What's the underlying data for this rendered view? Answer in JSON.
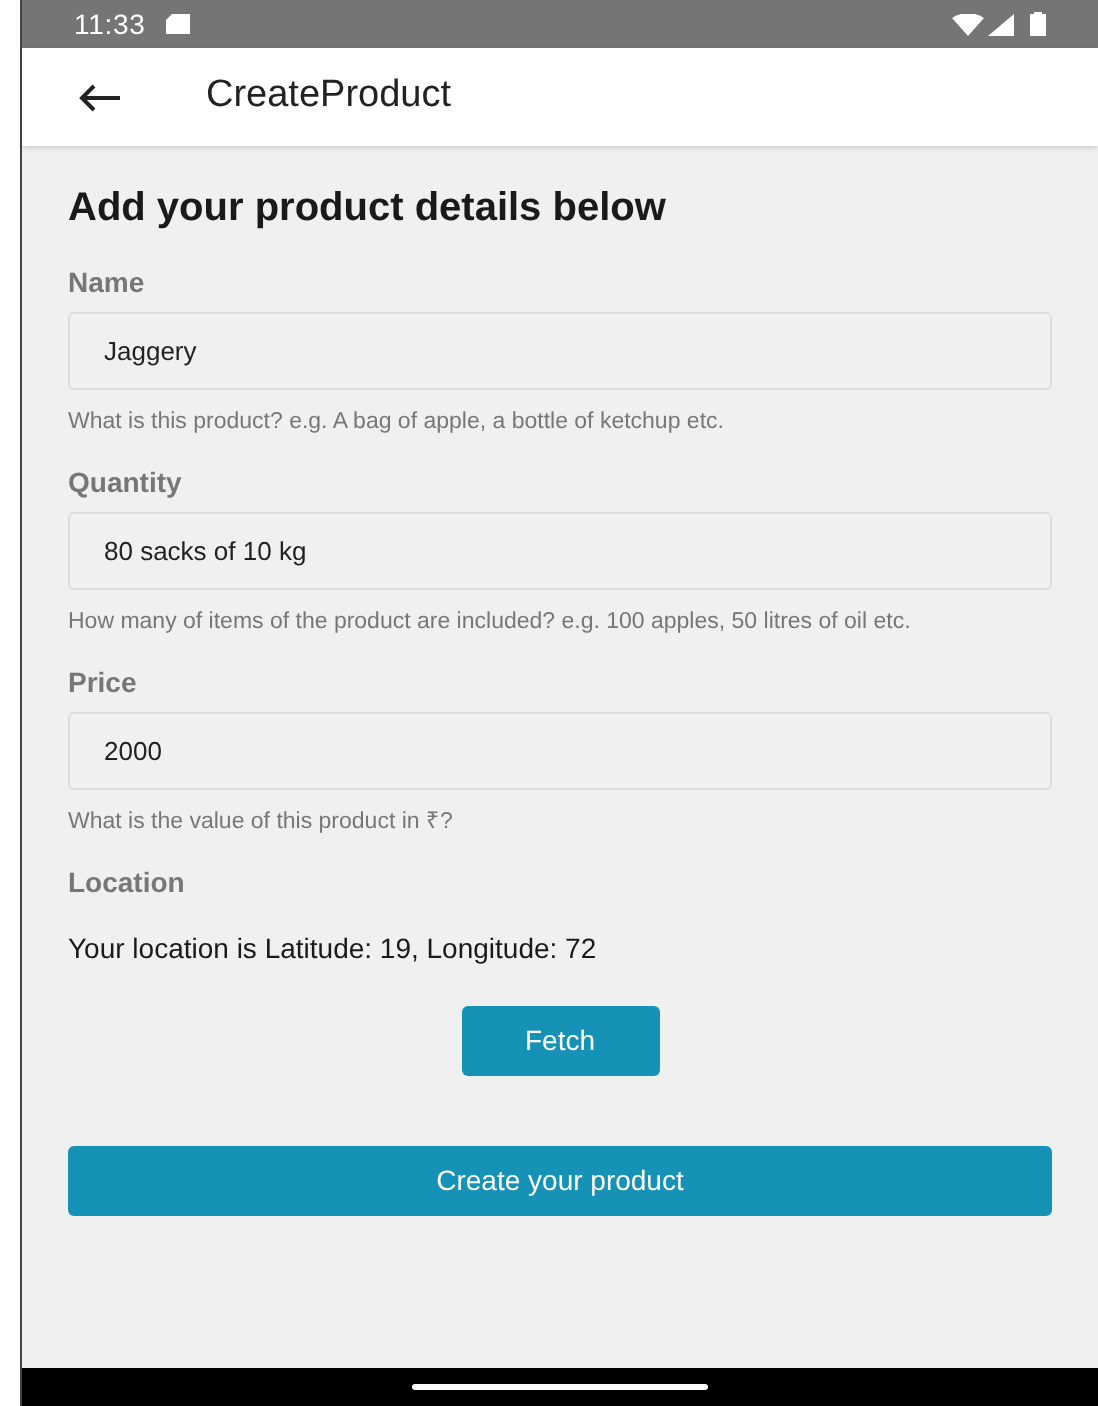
{
  "status_bar": {
    "time": "11:33"
  },
  "app_bar": {
    "title": "CreateProduct"
  },
  "heading": "Add your product details below",
  "fields": [
    {
      "label": "Name",
      "value": "Jaggery",
      "hint": "What is this product? e.g. A bag of apple, a bottle of ketchup etc."
    },
    {
      "label": "Quantity",
      "value": "80 sacks of 10 kg",
      "hint": "How many of items of the product are included? e.g. 100 apples, 50 litres of oil etc."
    },
    {
      "label": "Price",
      "value": "2000",
      "hint": "What is the value of this product in ₹?"
    }
  ],
  "location": {
    "label": "Location",
    "text": "Your location is Latitude: 19, Longitude: 72",
    "button": "Fetch"
  },
  "submit_button": "Create your product"
}
